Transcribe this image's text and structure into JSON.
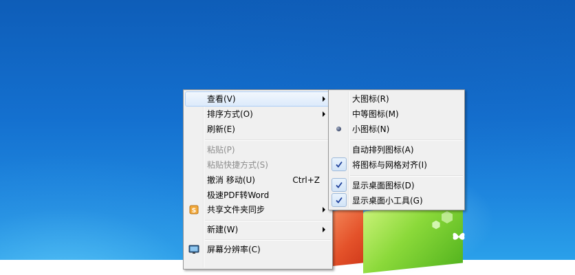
{
  "context_menu": {
    "items": [
      {
        "label": "查看(V)",
        "shortcut": "",
        "submenu": true,
        "disabled": false,
        "highlighted": true,
        "icon": ""
      },
      {
        "label": "排序方式(O)",
        "shortcut": "",
        "submenu": true,
        "disabled": false,
        "highlighted": false,
        "icon": ""
      },
      {
        "label": "刷新(E)",
        "shortcut": "",
        "submenu": false,
        "disabled": false,
        "highlighted": false,
        "icon": ""
      },
      {
        "label": "粘贴(P)",
        "shortcut": "",
        "submenu": false,
        "disabled": true,
        "highlighted": false,
        "icon": ""
      },
      {
        "label": "粘贴快捷方式(S)",
        "shortcut": "",
        "submenu": false,
        "disabled": true,
        "highlighted": false,
        "icon": ""
      },
      {
        "label": "撤消 移动(U)",
        "shortcut": "Ctrl+Z",
        "submenu": false,
        "disabled": false,
        "highlighted": false,
        "icon": ""
      },
      {
        "label": "极速PDF转Word",
        "shortcut": "",
        "submenu": false,
        "disabled": false,
        "highlighted": false,
        "icon": ""
      },
      {
        "label": "共享文件夹同步",
        "shortcut": "",
        "submenu": true,
        "disabled": false,
        "highlighted": false,
        "icon": "sync-folder-icon"
      },
      {
        "label": "新建(W)",
        "shortcut": "",
        "submenu": true,
        "disabled": false,
        "highlighted": false,
        "icon": ""
      },
      {
        "label": "屏幕分辨率(C)",
        "shortcut": "",
        "submenu": false,
        "disabled": false,
        "highlighted": false,
        "icon": "monitor-icon"
      }
    ]
  },
  "view_submenu": {
    "items": [
      {
        "label": "大图标(R)",
        "state": "none"
      },
      {
        "label": "中等图标(M)",
        "state": "none"
      },
      {
        "label": "小图标(N)",
        "state": "radio"
      },
      {
        "label": "自动排列图标(A)",
        "state": "none"
      },
      {
        "label": "将图标与网格对齐(I)",
        "state": "check"
      },
      {
        "label": "显示桌面图标(D)",
        "state": "check"
      },
      {
        "label": "显示桌面小工具(G)",
        "state": "check"
      }
    ]
  },
  "icons": {
    "submenu_arrow": "chevron-right-icon",
    "check": "checkmark-icon",
    "radio": "radio-dot-icon"
  },
  "colors": {
    "desktop_top": "#0e5db8",
    "desktop_bottom": "#2aa0ea",
    "menu_bg": "#f0f0f0",
    "highlight_border": "#aecff7",
    "check_blue": "#1d3f9a"
  }
}
